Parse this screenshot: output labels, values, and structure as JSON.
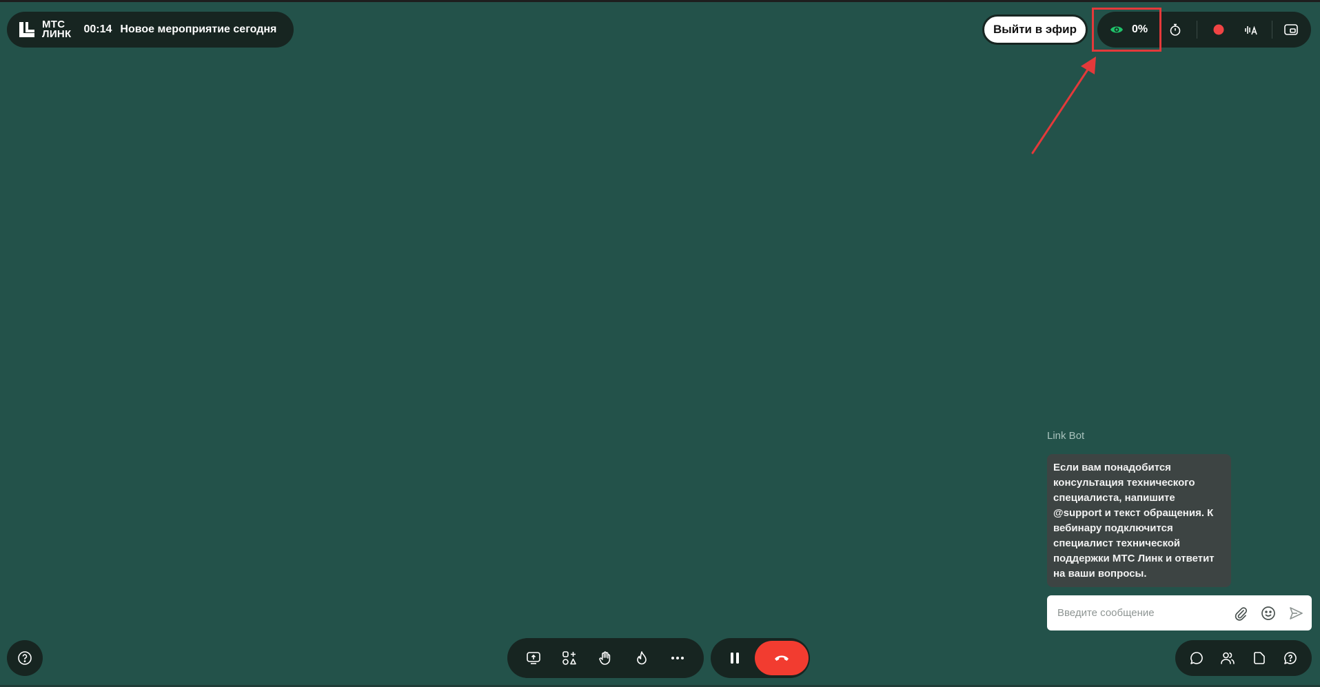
{
  "header": {
    "logo_line1": "МТС",
    "logo_line2": "ЛИНК",
    "timer": "00:14",
    "event_title": "Новое мероприятие сегодня"
  },
  "toolbar": {
    "go_live_label": "Выйти в эфир",
    "viewers_percent": "0%"
  },
  "chat": {
    "bot_name": "Link Bot",
    "bot_message": "Если вам понадобится консультация технического специалиста, напишите @support и текст обращения. К вебинару подключится специалист технической поддержки МТС Линк и ответит на ваши вопросы.",
    "input_placeholder": "Введите сообщение"
  },
  "colors": {
    "background": "#23524a",
    "panel": "#172521",
    "hangup": "#f23c30",
    "record_dot": "#f04444",
    "viewers_eye": "#1fc36a",
    "annotation": "#e4393a"
  },
  "icons": {
    "toolbar": [
      "eye-icon",
      "stopwatch-icon",
      "record-icon",
      "audio-subtitles-icon",
      "pip-icon"
    ],
    "bottom_controls": [
      "screen-share-icon",
      "apps-icon",
      "raise-hand-icon",
      "reaction-fire-icon",
      "more-icon"
    ],
    "call": [
      "pause-icon",
      "hangup-icon"
    ],
    "right_panel": [
      "chat-icon",
      "participants-icon",
      "files-icon",
      "questions-icon"
    ],
    "chat_input": [
      "attach-icon",
      "emoji-icon",
      "send-icon"
    ],
    "help": "help-icon"
  }
}
